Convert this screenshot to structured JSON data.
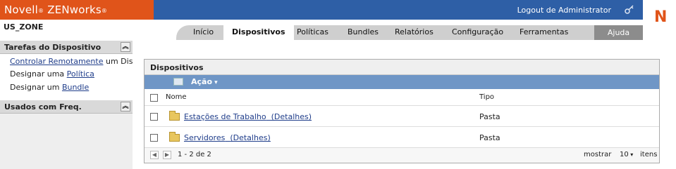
{
  "brand": {
    "product": "Novell",
    "mark1": "®",
    "name": "ZENworks",
    "mark2": "®"
  },
  "header": {
    "logout": "Logout de Administrator"
  },
  "zone": "US_ZONE",
  "tabs": [
    {
      "label": "Início"
    },
    {
      "label": "Dispositivos",
      "active": true
    },
    {
      "label": "Políticas"
    },
    {
      "label": "Bundles"
    },
    {
      "label": "Relatórios"
    },
    {
      "label": "Configuração"
    },
    {
      "label": "Ferramentas"
    }
  ],
  "help": "Ajuda",
  "sidebar": {
    "tasks_title": "Tarefas do Dispositivo",
    "tasks": [
      {
        "link": "Controlar Remotamente",
        "after": " um Dispositivo"
      },
      {
        "before": "Designar uma ",
        "link": "Política"
      },
      {
        "before": "Designar um ",
        "link": "Bundle"
      }
    ],
    "frequent_title": "Usados com Freq."
  },
  "panel": {
    "title": "Dispositivos",
    "action": "Ação",
    "columns": {
      "name": "Nome",
      "type": "Tipo"
    },
    "rows": [
      {
        "name": "Estações de Trabalho",
        "details": "(Detalhes)",
        "type": "Pasta"
      },
      {
        "name": "Servidores",
        "details": "(Detalhes)",
        "type": "Pasta"
      }
    ],
    "footer": {
      "range": "1 - 2 de 2",
      "show": "mostrar",
      "per_page": "10",
      "items": "itens"
    }
  },
  "colors": {
    "brand_orange": "#e0541a",
    "banner_blue": "#2e5fa6",
    "action_blue": "#6f96c6",
    "link": "#1f3d8a"
  },
  "icons": [
    "key-icon",
    "novell-n-logo",
    "collapse-icon",
    "folder-icon",
    "action-icon"
  ]
}
